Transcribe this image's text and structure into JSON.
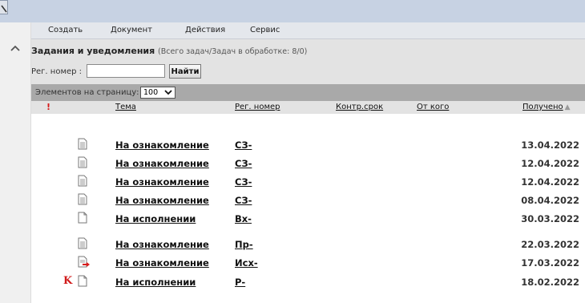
{
  "menu": [
    "Создать",
    "Документ",
    "Действия",
    "Сервис"
  ],
  "panel": {
    "title": "Задания и уведомления",
    "subtitle": "(Всего задач/Задач в обработке: 8/0)",
    "reg_label": "Рег. номер :",
    "reg_value": "",
    "find_label": "Найти"
  },
  "perpage": {
    "label": "Элементов на страницу:",
    "value": "100"
  },
  "columns": {
    "importance": "!",
    "subject": "Тема",
    "reg": "Рег. номер",
    "deadline": "Контр.срок",
    "from": "От кого",
    "received": "Получено",
    "sort_indicator": "▲"
  },
  "rows": [
    {
      "mark": "",
      "subject": "На ознакомление",
      "reg": "СЗ-",
      "date": "13.04.2022",
      "icon": "doc-lines-icon"
    },
    {
      "mark": "",
      "subject": "На ознакомление",
      "reg": "СЗ-",
      "date": "12.04.2022",
      "icon": "doc-lines-icon"
    },
    {
      "mark": "",
      "subject": "На ознакомление",
      "reg": "СЗ-",
      "date": "12.04.2022",
      "icon": "doc-lines-icon"
    },
    {
      "mark": "",
      "subject": "На ознакомление",
      "reg": "СЗ-",
      "date": "08.04.2022",
      "icon": "doc-lines-icon"
    },
    {
      "mark": "",
      "subject": "На исполнении",
      "reg": "Вх-",
      "date": "30.03.2022",
      "icon": "doc-blank-icon"
    },
    {
      "mark": "",
      "subject": "На ознакомление",
      "reg": "Пр-",
      "date": "22.03.2022",
      "icon": "doc-lines-icon"
    },
    {
      "mark": "",
      "subject": "На ознакомление",
      "reg": "Исх-",
      "date": "17.03.2022",
      "icon": "doc-outgoing-icon"
    },
    {
      "mark": "K",
      "subject": "На исполнении",
      "reg": "Р-",
      "date": "18.02.2022",
      "icon": "doc-blank-icon"
    }
  ],
  "colors": {
    "top_strip": "#c7d2e3",
    "menu_bg": "#e4e7ec",
    "panel_bg": "#e3e3e3",
    "perpage_bg": "#a9a9a9",
    "mark": "#d11a1a"
  }
}
